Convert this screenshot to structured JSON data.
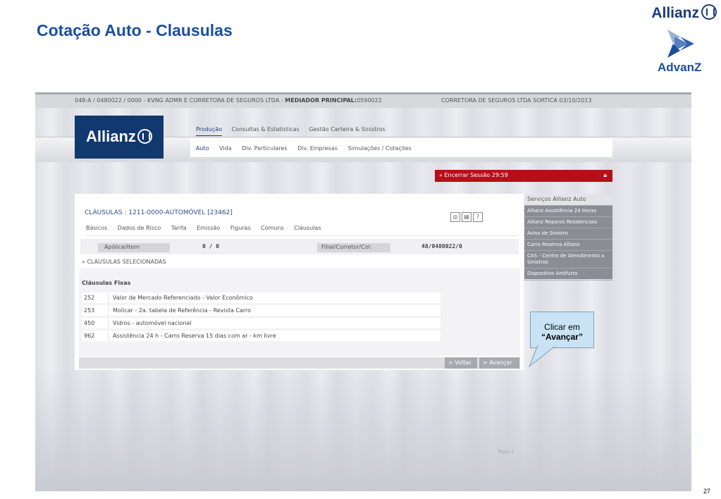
{
  "slide": {
    "title": "Cotação Auto - Clausulas",
    "page_number": "27",
    "brand_allianz": "Allianz",
    "brand_advanz": "AdvanZ"
  },
  "topbar": {
    "left_prefix": "048-A / 0480022 / 0000 - KVNG ADMR E CORRETORA DE SEGUROS LTDA - ",
    "mediator_label": "MEDIADOR PRINCIPAL:",
    "mediator_value": "0590022",
    "right": "CORRETORA DE SEGUROS LTDA SORTICA 03/10/2013"
  },
  "logo": {
    "text": "Allianz"
  },
  "nav_primary": [
    "Produção",
    "Consultas & Estatísticas",
    "Gestão Carteira & Sinistros"
  ],
  "nav_secondary": [
    "Auto",
    "Vida",
    "Div. Particulares",
    "Div. Empresas",
    "Simulações / Cotações"
  ],
  "session": {
    "label": "» Encerrar Sessão 29:59",
    "lock_icon": "lock-icon"
  },
  "panel": {
    "title": "CLÁUSULAS : 1211-0000-AUTOMÓVEL [23462]",
    "tools": [
      "globe-icon",
      "print-icon",
      "help-icon"
    ],
    "tabs": [
      "Básicos",
      "Dados de Risco",
      "Tarifa",
      "Emissão",
      "Figuras",
      "Comuns",
      "Cláusulas"
    ],
    "apolice_label": "Apólice/Item",
    "apolice_value": "0 / 0",
    "filial_label": "Filial/Corretor/Col:",
    "filial_value": "48/0480022/0",
    "selected_title": "» CLÁUSULAS SELECIONADAS",
    "fixed_caption": "Cláusulas Fixas",
    "clauses": [
      {
        "code": "252",
        "desc": "Valor de Mercado Referenciado - Valor Econômico"
      },
      {
        "code": "253",
        "desc": "Molicar - 2a. tabela de Referência - Revista Carro"
      },
      {
        "code": "450",
        "desc": "Vidros - automóvel nacional"
      },
      {
        "code": "962",
        "desc": "Assistência 24 h - Carro Reserva 15 dias com ar - km livre"
      }
    ],
    "btn_back": "> Voltar",
    "btn_next": "> Avançar"
  },
  "topo": "Topo ⇑",
  "side_menu": {
    "head": "Serviços Allianz Auto",
    "items": [
      "Allianz Assistência 24 Horas",
      "Allianz Reparos Residenciais",
      "Aviso de Sinistro",
      "Carro Reserva Allianz",
      "CAS - Centro de Atendimento a Sinistros",
      "Dispositivo Antifurto"
    ]
  },
  "callout": {
    "line1": "Clicar em",
    "line2": "“Avançar”"
  },
  "colors": {
    "title_blue": "#1a4fa0",
    "navy": "#11386f",
    "session_red": "#b80e18",
    "callout_bg": "#c9e3f5"
  }
}
